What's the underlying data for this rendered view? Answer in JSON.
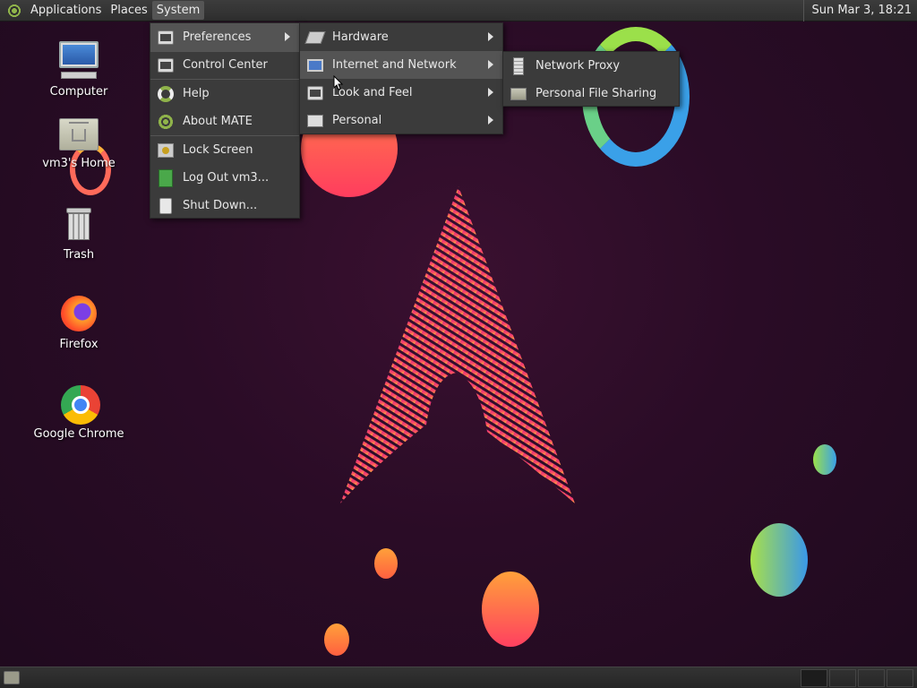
{
  "top_panel": {
    "menus": [
      "Applications",
      "Places",
      "System"
    ],
    "clock": "Sun Mar  3, 18:21"
  },
  "desktop": {
    "icons": [
      {
        "label": "Computer",
        "icon": "computer-icon"
      },
      {
        "label": "vm3's Home",
        "icon": "home-folder-icon"
      },
      {
        "label": "Trash",
        "icon": "trash-icon"
      },
      {
        "label": "Firefox",
        "icon": "firefox-icon"
      },
      {
        "label": "Google Chrome",
        "icon": "chrome-icon"
      }
    ]
  },
  "system_menu": {
    "items": [
      {
        "label": "Preferences",
        "icon": "preferences-icon",
        "submenu": true
      },
      {
        "label": "Control Center",
        "icon": "control-center-icon"
      },
      {
        "label": "Help",
        "icon": "help-icon"
      },
      {
        "label": "About MATE",
        "icon": "mate-icon"
      },
      {
        "label": "Lock Screen",
        "icon": "lock-screen-icon"
      },
      {
        "label": "Log Out vm3...",
        "icon": "logout-icon"
      },
      {
        "label": "Shut Down...",
        "icon": "shutdown-icon"
      }
    ]
  },
  "preferences_menu": {
    "items": [
      {
        "label": "Hardware",
        "icon": "hardware-icon"
      },
      {
        "label": "Internet and Network",
        "icon": "network-icon"
      },
      {
        "label": "Look and Feel",
        "icon": "look-and-feel-icon"
      },
      {
        "label": "Personal",
        "icon": "personal-icon"
      }
    ]
  },
  "network_menu": {
    "items": [
      {
        "label": "Network Proxy",
        "icon": "network-proxy-icon"
      },
      {
        "label": "Personal File Sharing",
        "icon": "file-sharing-icon"
      }
    ]
  },
  "colors": {
    "panel": "#2e2e2e",
    "menu_bg": "#3b3b3b",
    "menu_highlight": "#545454",
    "arch_pink": "#e8307a",
    "arch_yellow": "#f5c23a"
  }
}
